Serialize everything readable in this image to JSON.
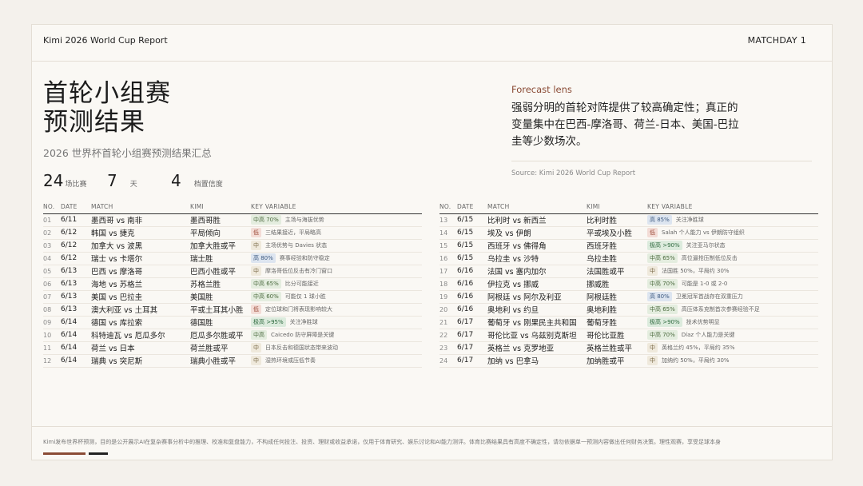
{
  "header": {
    "brand": "Kimi 2026 World Cup Report",
    "matchday": "MATCHDAY 1"
  },
  "title_lines": [
    "首轮小组赛",
    "预测结果"
  ],
  "subtitle": "2026 世界杯首轮小组赛预测结果汇总",
  "stats": [
    {
      "num": "24",
      "label": "场比赛"
    },
    {
      "num": "7",
      "label": "天"
    },
    {
      "num": "4",
      "label": "档置信度"
    }
  ],
  "lens": {
    "label": "Forecast lens",
    "text": "强弱分明的首轮对阵提供了较高确定性；真正的变量集中在巴西-摩洛哥、荷兰-日本、美国-巴拉圭等少数场次。",
    "source": "Source: Kimi 2026 World Cup Report"
  },
  "columns": {
    "no": "NO.",
    "date": "DATE",
    "match": "MATCH",
    "kimi": "KIMI",
    "variable": "KEY VARIABLE"
  },
  "left_rows": [
    {
      "no": "01",
      "date": "6/11",
      "match": "墨西哥 vs 南非",
      "kimi": "墨西哥胜",
      "badge": "中高 70%",
      "tone": "mid",
      "note": "主场与海拔优势"
    },
    {
      "no": "02",
      "date": "6/12",
      "match": "韩国 vs 捷克",
      "kimi": "平局倾向",
      "badge": "低",
      "tone": "low",
      "note": "三结果接近，平局略高"
    },
    {
      "no": "03",
      "date": "6/12",
      "match": "加拿大 vs 波黑",
      "kimi": "加拿大胜或平",
      "badge": "中",
      "tone": "neu",
      "note": "主场优势与 Davies 状态"
    },
    {
      "no": "04",
      "date": "6/12",
      "match": "瑞士 vs 卡塔尔",
      "kimi": "瑞士胜",
      "badge": "高 80%",
      "tone": "high",
      "note": "赛事经验和防守稳定"
    },
    {
      "no": "05",
      "date": "6/13",
      "match": "巴西 vs 摩洛哥",
      "kimi": "巴西小胜或平",
      "badge": "中",
      "tone": "neu",
      "note": "摩洛哥低位反击有冷门窗口"
    },
    {
      "no": "06",
      "date": "6/13",
      "match": "海地 vs 苏格兰",
      "kimi": "苏格兰胜",
      "badge": "中高 65%",
      "tone": "mid",
      "note": "比分可能接近"
    },
    {
      "no": "07",
      "date": "6/13",
      "match": "美国 vs 巴拉圭",
      "kimi": "美国胜",
      "badge": "中高 60%",
      "tone": "mid",
      "note": "可能仅 1 球小胜"
    },
    {
      "no": "08",
      "date": "6/13",
      "match": "澳大利亚 vs 土耳其",
      "kimi": "平或土耳其小胜",
      "badge": "低",
      "tone": "low",
      "note": "定位球和门将表现影响较大"
    },
    {
      "no": "09",
      "date": "6/14",
      "match": "德国 vs 库拉索",
      "kimi": "德国胜",
      "badge": "极高 >95%",
      "tone": "vhigh",
      "note": "关注净胜球"
    },
    {
      "no": "10",
      "date": "6/14",
      "match": "科特迪瓦 vs 厄瓜多尔",
      "kimi": "厄瓜多尔胜或平",
      "badge": "中高",
      "tone": "mid",
      "note": "Caicedo 防守屏障是关键"
    },
    {
      "no": "11",
      "date": "6/14",
      "match": "荷兰 vs 日本",
      "kimi": "荷兰胜或平",
      "badge": "中",
      "tone": "neu",
      "note": "日本反击和德国状态带来波动"
    },
    {
      "no": "12",
      "date": "6/14",
      "match": "瑞典 vs 突尼斯",
      "kimi": "瑞典小胜或平",
      "badge": "中",
      "tone": "neu",
      "note": "湿热环境或压低节奏"
    }
  ],
  "right_rows": [
    {
      "no": "13",
      "date": "6/15",
      "match": "比利时 vs 新西兰",
      "kimi": "比利时胜",
      "badge": "高 85%",
      "tone": "high",
      "note": "关注净胜球"
    },
    {
      "no": "14",
      "date": "6/15",
      "match": "埃及 vs 伊朗",
      "kimi": "平或埃及小胜",
      "badge": "低",
      "tone": "low",
      "note": "Salah 个人能力 vs 伊朗防守组织"
    },
    {
      "no": "15",
      "date": "6/15",
      "match": "西班牙 vs 佛得角",
      "kimi": "西班牙胜",
      "badge": "极高 >90%",
      "tone": "vhigh",
      "note": "关注亚马尔状态"
    },
    {
      "no": "16",
      "date": "6/15",
      "match": "乌拉圭 vs 沙特",
      "kimi": "乌拉圭胜",
      "badge": "中高 65%",
      "tone": "mid",
      "note": "高位逼抢压制低位反击"
    },
    {
      "no": "17",
      "date": "6/16",
      "match": "法国 vs 塞内加尔",
      "kimi": "法国胜或平",
      "badge": "中",
      "tone": "neu",
      "note": "法国胜 50%，平局约 30%"
    },
    {
      "no": "18",
      "date": "6/16",
      "match": "伊拉克 vs 挪威",
      "kimi": "挪威胜",
      "badge": "中高 70%",
      "tone": "mid",
      "note": "可能是 1-0 或 2-0"
    },
    {
      "no": "19",
      "date": "6/16",
      "match": "阿根廷 vs 阿尔及利亚",
      "kimi": "阿根廷胜",
      "badge": "高 80%",
      "tone": "high",
      "note": "卫冕冠军首战存在双重压力"
    },
    {
      "no": "20",
      "date": "6/16",
      "match": "奥地利 vs 约旦",
      "kimi": "奥地利胜",
      "badge": "中高 65%",
      "tone": "mid",
      "note": "高压体系克制首次参赛经验不足"
    },
    {
      "no": "21",
      "date": "6/17",
      "match": "葡萄牙 vs 刚果民主共和国",
      "kimi": "葡萄牙胜",
      "badge": "极高 >90%",
      "tone": "vhigh",
      "note": "技术优势明显"
    },
    {
      "no": "22",
      "date": "6/17",
      "match": "哥伦比亚 vs 乌兹别克斯坦",
      "kimi": "哥伦比亚胜",
      "badge": "中高 70%",
      "tone": "mid",
      "note": "Díaz 个人能力是关键"
    },
    {
      "no": "23",
      "date": "6/17",
      "match": "英格兰 vs 克罗地亚",
      "kimi": "英格兰胜或平",
      "badge": "中",
      "tone": "neu",
      "note": "英格兰约 45%，平局约 35%"
    },
    {
      "no": "24",
      "date": "6/17",
      "match": "加纳 vs 巴拿马",
      "kimi": "加纳胜或平",
      "badge": "中",
      "tone": "neu",
      "note": "加纳约 50%，平局约 30%"
    }
  ],
  "disclaimer": "Kimi发布世界杯预测，目的是公开展示AI在复杂赛事分析中的推理、校准和复盘能力，不构成任何投注、投资、理财或收益承诺，仅用于体育研究、娱乐讨论和AI能力测评。体育比赛结果具有高度不确定性，请勿依据单一预测内容做出任何财务决策。理性观赛，享受足球本身"
}
